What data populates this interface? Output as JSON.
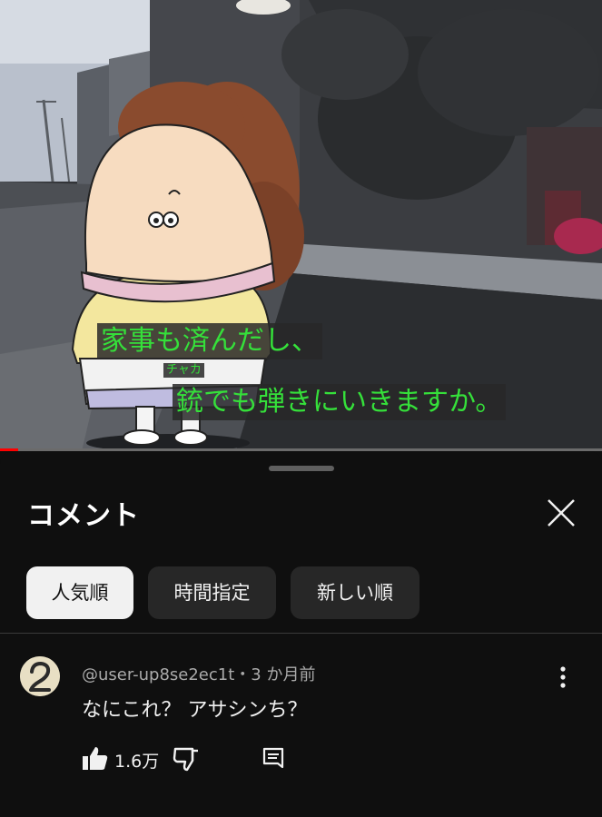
{
  "video": {
    "subtitle_line1": "家事も済んだし、",
    "subtitle_ruby": "チャカ",
    "subtitle_line2": "銃でも弾きにいきますか。",
    "progress": 0.03,
    "subtitle_color": "#35e03a",
    "progress_color": "#ff0000"
  },
  "panel": {
    "title": "コメント",
    "close_icon": "close-icon",
    "chips": [
      {
        "label": "人気順",
        "active": true
      },
      {
        "label": "時間指定",
        "active": false
      },
      {
        "label": "新しい順",
        "active": false
      }
    ]
  },
  "comment": {
    "meta": "@user-up8se2ec1t・3 か月前",
    "text": "なにこれ？ アサシンち？",
    "avatar_icon": "number-2-avatar",
    "likes": "1.6万",
    "actions": [
      "like-icon",
      "dislike-icon",
      "reply-icon",
      "more-vert-icon"
    ]
  }
}
